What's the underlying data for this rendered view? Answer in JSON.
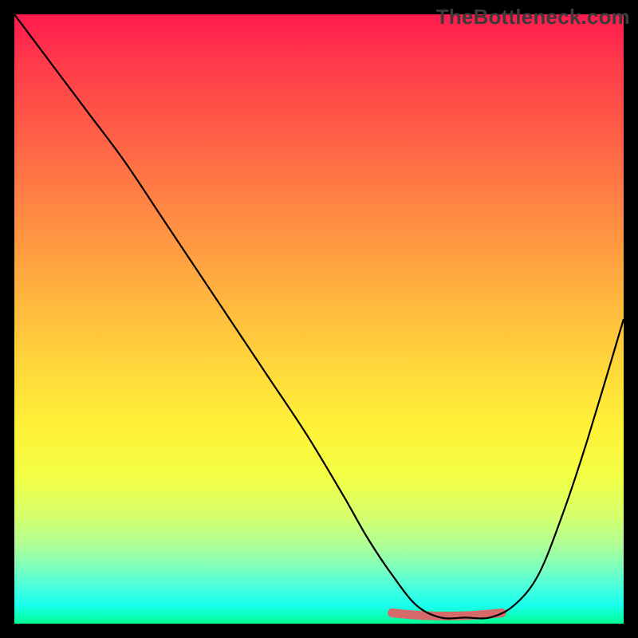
{
  "watermark": "TheBottleneck.com",
  "chart_data": {
    "type": "line",
    "title": "",
    "xlabel": "",
    "ylabel": "",
    "xlim": [
      0,
      100
    ],
    "ylim": [
      0,
      100
    ],
    "grid": false,
    "legend": false,
    "background_gradient": {
      "top": "#ff1a4d",
      "middle": "#ffd83b",
      "bottom": "#00ff93"
    },
    "series": [
      {
        "name": "bottleneck-curve",
        "color": "#000000",
        "x": [
          0,
          6,
          12,
          18,
          24,
          30,
          36,
          42,
          48,
          54,
          58,
          62,
          66,
          70,
          74,
          78,
          82,
          86,
          90,
          94,
          100
        ],
        "y": [
          100,
          92,
          84,
          76,
          67,
          58,
          49,
          40,
          31,
          21,
          14,
          8,
          3,
          1,
          1,
          1,
          3,
          8,
          18,
          30,
          50
        ]
      }
    ],
    "annotations": [
      {
        "name": "optimal-range-marker",
        "type": "segment",
        "color": "#d66a6a",
        "x0": 62,
        "x1": 80,
        "y": 1.5
      }
    ]
  }
}
